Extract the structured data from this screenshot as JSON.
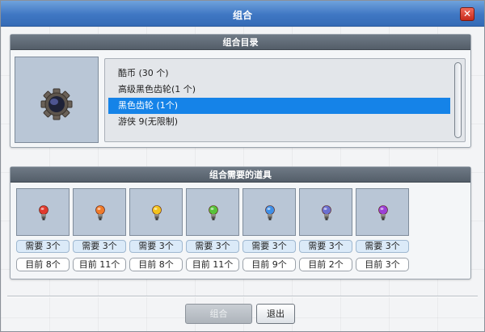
{
  "window": {
    "title": "组合",
    "close_glyph": "✕"
  },
  "catalog": {
    "header": "组合目录",
    "preview_icon": "black-gear-icon",
    "items": [
      {
        "label": "酷币 (30 个)"
      },
      {
        "label": "高级黑色齿轮(1 个)"
      },
      {
        "label": "黑色齿轮 (1个)",
        "selected": true
      },
      {
        "label": "游侠 9(无限制)"
      }
    ]
  },
  "materials": {
    "header": "组合需要的道具",
    "slots": [
      {
        "icon": "red-bulb-icon",
        "color": "#e03a2e",
        "need": "需要 3个",
        "have": "目前 8个"
      },
      {
        "icon": "orange-bulb-icon",
        "color": "#ef7a2a",
        "need": "需要 3个",
        "have": "目前 11个"
      },
      {
        "icon": "yellow-bulb-icon",
        "color": "#f2c21c",
        "need": "需要 3个",
        "have": "目前 8个"
      },
      {
        "icon": "green-bulb-icon",
        "color": "#57c23a",
        "need": "需要 3个",
        "have": "目前 11个"
      },
      {
        "icon": "blue-bulb-icon",
        "color": "#3f8fe6",
        "need": "需要 3个",
        "have": "目前 9个"
      },
      {
        "icon": "indigo-bulb-icon",
        "color": "#6a6fcf",
        "need": "需要 3个",
        "have": "目前 2个"
      },
      {
        "icon": "purple-bulb-icon",
        "color": "#9b3fd6",
        "need": "需要 3个",
        "have": "目前 3个"
      }
    ]
  },
  "buttons": {
    "combine": "组合",
    "exit": "退出"
  },
  "colors": {
    "titlebar": "#3f77c3",
    "selection": "#1583e8",
    "panel_header": "#5f6a75"
  }
}
